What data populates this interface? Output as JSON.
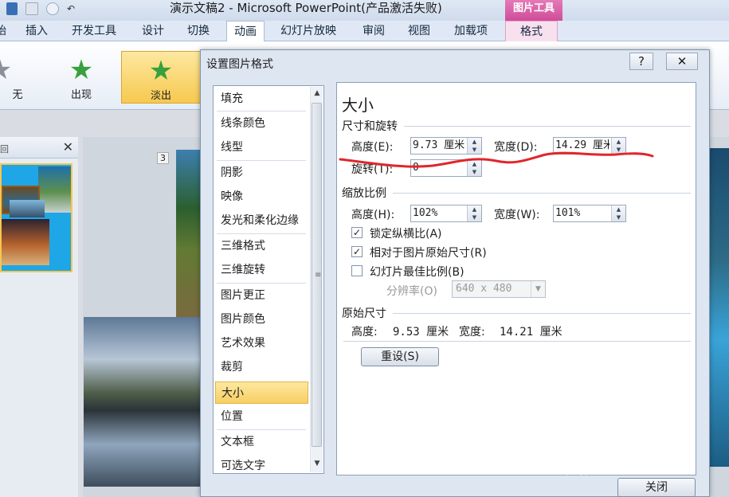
{
  "titlebar": {
    "window_title": "演示文稿2 - Microsoft PowerPoint(产品激活失败)",
    "context_tools": "图片工具",
    "qat_redo": "↶"
  },
  "ribbon": {
    "tabs": [
      "始",
      "插入",
      "开发工具",
      "设计",
      "切换",
      "动画",
      "幻灯片放映",
      "审阅",
      "视图",
      "加载项"
    ],
    "context_tab": "格式",
    "animations": [
      "无",
      "出现",
      "淡出"
    ]
  },
  "left_pane": {
    "close": "✕",
    "tab_mark": "回"
  },
  "slide": {
    "number": "3"
  },
  "dialog": {
    "title": "设置图片格式",
    "help": "?",
    "close_x": "✕",
    "categories": [
      "填充",
      "线条颜色",
      "线型",
      "阴影",
      "映像",
      "发光和柔化边缘",
      "三维格式",
      "三维旋转",
      "图片更正",
      "图片颜色",
      "艺术效果",
      "裁剪",
      "大小",
      "位置",
      "文本框",
      "可选文字"
    ],
    "selected_category": "大小",
    "panel": {
      "title": "大小",
      "section_size": "尺寸和旋转",
      "height_label": "高度(E):",
      "height_value": "9.73 厘米",
      "width_label": "宽度(D):",
      "width_value": "14.29 厘米",
      "rotation_label": "旋转(T):",
      "rotation_value": "0",
      "section_scale": "缩放比例",
      "scale_height_label": "高度(H):",
      "scale_height_value": "102%",
      "scale_width_label": "宽度(W):",
      "scale_width_value": "101%",
      "lock_ratio_label": "锁定纵横比(A)",
      "lock_ratio_checked": true,
      "relative_label": "相对于图片原始尺寸(R)",
      "relative_checked": true,
      "best_scale_label": "幻灯片最佳比例(B)",
      "best_scale_checked": false,
      "resolution_label": "分辨率(O)",
      "resolution_value": "640 x 480",
      "section_original": "原始尺寸",
      "original_height_label": "高度:",
      "original_height_value": "9.53 厘米",
      "original_width_label": "宽度:",
      "original_width_value": "14.21 厘米",
      "reset_button": "重设(S)"
    },
    "close_button": "关闭"
  },
  "watermark": {
    "brand": "Baidu 经验",
    "url": "jingyan.baidu.com"
  },
  "colors": {
    "context_pink": "#cf4c99",
    "selection_gold": "#f7cf63",
    "annotation_red": "#e0262b",
    "star_green": "#38a03c"
  }
}
